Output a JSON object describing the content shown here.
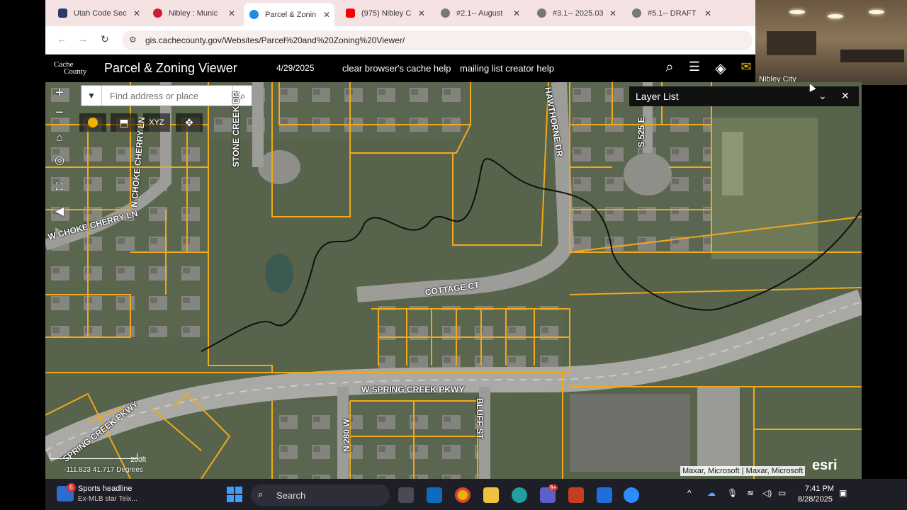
{
  "browser": {
    "tabs": [
      {
        "title": "Utah Code Sec",
        "icon": "utah-code-icon",
        "color": "#2b3a67",
        "active": false
      },
      {
        "title": "Nibley : Munic",
        "icon": "youtube-icon",
        "color": "#cc1f2d",
        "active": false
      },
      {
        "title": "Parcel & Zonin",
        "icon": "arcgis-icon",
        "color": "#1f8ce0",
        "active": true
      },
      {
        "title": "(975) Nibley C",
        "icon": "youtube-icon",
        "color": "#ff0000",
        "active": false
      },
      {
        "title": "#2.1-- August",
        "icon": "globe-icon",
        "color": "#777777",
        "active": false
      },
      {
        "title": "#3.1-- 2025.03",
        "icon": "globe-icon",
        "color": "#777777",
        "active": false
      },
      {
        "title": "#5.1-- DRAFT",
        "icon": "globe-icon",
        "color": "#777777",
        "active": false
      }
    ],
    "url": "gis.cachecounty.gov/Websites/Parcel%20and%20Zoning%20Viewer/"
  },
  "video": {
    "label": "Nibley City"
  },
  "app": {
    "logo_line1": "Cache",
    "logo_line2": "County",
    "title": "Parcel & Zoning Viewer",
    "date": "4/29/2025",
    "links": [
      "clear browser's cache help",
      "mailing list creator help"
    ]
  },
  "map": {
    "search_placeholder": "Find address or place",
    "tools": [
      "coins-icon",
      "bookmark-icon",
      "xyz-icon",
      "move-icon"
    ],
    "tool_xyz_label": "XYZ",
    "streets": {
      "stone_creek": "STONE CREEK DR",
      "hawthorne": "HAWTHORNE DR",
      "s525e": "S 525 E",
      "n_choke": "N CHOKE CHERRY LN",
      "w_choke": "W CHOKE CHERRY LN",
      "cottage": "COTTAGE CT",
      "spring_creek": "W SPRING CREEK PKWY",
      "spring_creek_left": "SPRING CREEK PKWY",
      "n280w": "N 280 W",
      "bluff": "BLUFF ST"
    },
    "scale_label": "200ft",
    "coords": "-111.823 41.717 Degrees",
    "attribution": "Maxar, Microsoft | Maxar, Microsoft",
    "esri": "esri",
    "colors": {
      "parcel": "#f0a91b",
      "imagery": "#566048",
      "creek": "#111111"
    }
  },
  "layer_panel": {
    "title": "Layer List"
  },
  "taskbar": {
    "news_title": "Sports headline",
    "news_sub": "Ex-MLB star Teix...",
    "news_badge": "6",
    "search_label": "Search",
    "teams_badge": "9+",
    "time": "7:41 PM",
    "date": "8/28/2025"
  }
}
